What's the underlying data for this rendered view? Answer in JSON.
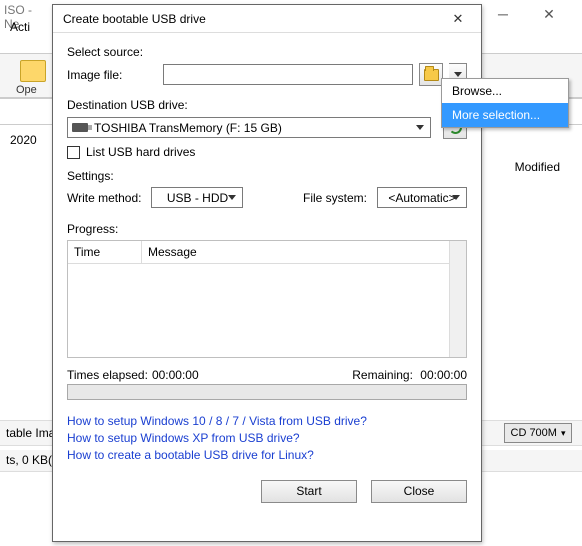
{
  "bg": {
    "title_frag": "ISO - Ne",
    "actions_frag": "Acti",
    "open_frag": "Ope",
    "date": "2020",
    "modified": "Modified",
    "status1": "table Imag",
    "status2": "ts, 0 KB(",
    "cd": "CD 700M"
  },
  "dialog": {
    "title": "Create bootable USB drive",
    "select_source": "Select source:",
    "image_file": "Image file:",
    "image_value": "",
    "dest_label": "Destination USB drive:",
    "usb_value": "TOSHIBA TransMemory (F:  15 GB)",
    "list_hd": "List USB hard drives",
    "settings": "Settings:",
    "write_method": "Write method:",
    "write_value": "USB - HDD",
    "file_system": "File system:",
    "fs_value": "<Automatic>",
    "progress": "Progress:",
    "col_time": "Time",
    "col_message": "Message",
    "elapsed_label": "Times elapsed:",
    "elapsed_value": "00:00:00",
    "remaining_label": "Remaining:",
    "remaining_value": "00:00:00",
    "link1": "How to setup Windows 10 / 8 / 7 / Vista from USB drive?",
    "link2": "How to setup Windows XP from USB drive?",
    "link3": "How to create a bootable USB drive for Linux?",
    "start": "Start",
    "close": "Close"
  },
  "popup": {
    "browse": "Browse...",
    "more": "More selection..."
  }
}
